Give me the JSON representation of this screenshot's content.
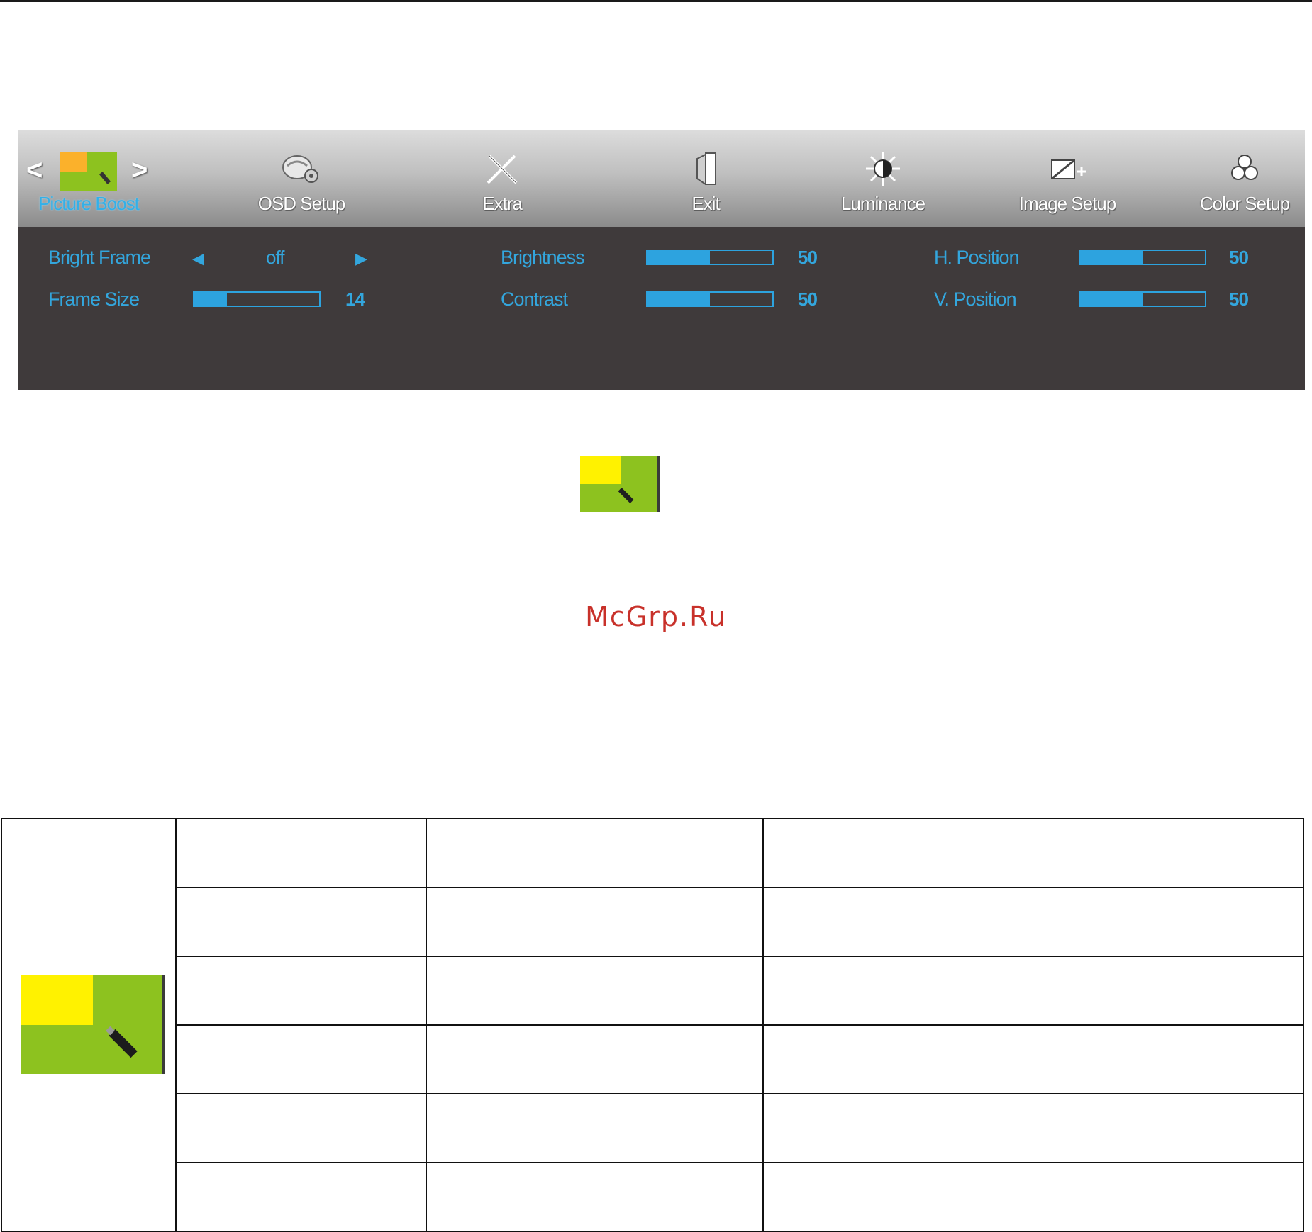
{
  "osd": {
    "tabs": [
      {
        "label": "Picture Boost",
        "icon": "picture-boost-icon",
        "active": true
      },
      {
        "label": "OSD Setup",
        "icon": "osd-setup-icon"
      },
      {
        "label": "Extra",
        "icon": "extra-tools-icon"
      },
      {
        "label": "Exit",
        "icon": "exit-door-icon"
      },
      {
        "label": "Luminance",
        "icon": "luminance-sun-icon"
      },
      {
        "label": "Image Setup",
        "icon": "image-setup-icon"
      },
      {
        "label": "Color Setup",
        "icon": "color-setup-icon"
      }
    ],
    "nav_left": "<",
    "nav_right": ">",
    "settings": {
      "bright_frame": {
        "label": "Bright Frame",
        "value": "off"
      },
      "frame_size": {
        "label": "Frame Size",
        "value": "14",
        "level": 0.26
      },
      "brightness": {
        "label": "Brightness",
        "value": "50",
        "level": 0.5
      },
      "contrast": {
        "label": "Contrast",
        "value": "50",
        "level": 0.5
      },
      "h_position": {
        "label": "H. Position",
        "value": "50",
        "level": 0.5
      },
      "v_position": {
        "label": "V. Position",
        "value": "50",
        "level": 0.5
      }
    },
    "colors": {
      "accent": "#2da3df",
      "panel": "#3f3a3b",
      "icon_green": "#8dc21f",
      "icon_yellow": "#fff200"
    }
  },
  "watermark": "McGrp.Ru"
}
